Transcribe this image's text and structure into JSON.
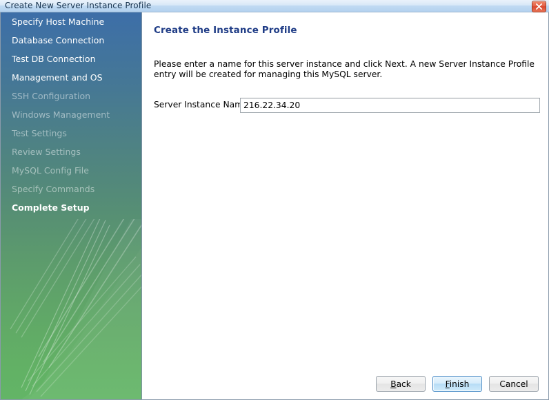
{
  "window": {
    "title": "Create New Server Instance Profile",
    "close_icon": "close-icon"
  },
  "sidebar": {
    "items": [
      {
        "label": "Specify Host Machine",
        "state": "done"
      },
      {
        "label": "Database Connection",
        "state": "done"
      },
      {
        "label": "Test DB Connection",
        "state": "done"
      },
      {
        "label": "Management and OS",
        "state": "done"
      },
      {
        "label": "SSH Configuration",
        "state": "pending"
      },
      {
        "label": "Windows Management",
        "state": "pending"
      },
      {
        "label": "Test Settings",
        "state": "pending"
      },
      {
        "label": "Review Settings",
        "state": "pending"
      },
      {
        "label": "MySQL Config File",
        "state": "pending"
      },
      {
        "label": "Specify Commands",
        "state": "pending"
      },
      {
        "label": "Complete Setup",
        "state": "current"
      }
    ]
  },
  "main": {
    "page_title": "Create the Instance Profile",
    "description": "Please enter a name for this server instance and click Next. A new Server Instance Profile entry will be created for managing this MySQL server.",
    "field_label": "Server Instance Name:",
    "field_value": "216.22.34.20",
    "field_placeholder": ""
  },
  "buttons": [
    {
      "label": "Back",
      "accel": "B",
      "default": false,
      "name": "back-button"
    },
    {
      "label": "Finish",
      "accel": "F",
      "default": true,
      "name": "finish-button"
    },
    {
      "label": "Cancel",
      "accel": "",
      "default": false,
      "name": "cancel-button"
    }
  ],
  "colors": {
    "title_accent": "#1f3c86",
    "sidebar_top": "#3d6ea8",
    "sidebar_bottom": "#63b566",
    "close_button": "#d9472f",
    "default_button_border": "#4b8dc7"
  }
}
